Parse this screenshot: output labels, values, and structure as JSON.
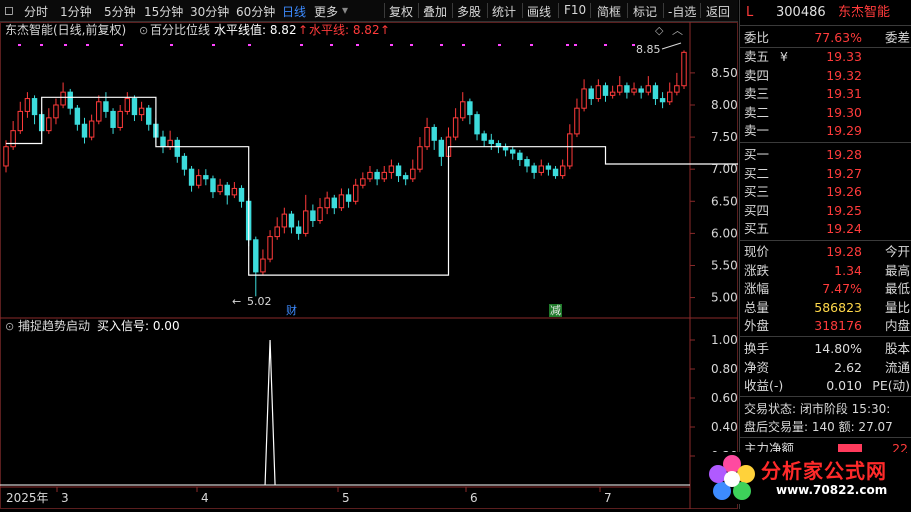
{
  "toolbar": {
    "periods": [
      "分时",
      "1分钟",
      "5分钟",
      "15分钟",
      "30分钟",
      "60分钟",
      "日线",
      "更多"
    ],
    "active_period": "日线",
    "actions": [
      "复权",
      "叠加",
      "多股",
      "统计",
      "画线",
      "F10",
      "简框",
      "标记",
      "-自选",
      "返回"
    ]
  },
  "chart": {
    "stock_title": "东杰智能(日线,前复权)",
    "indicator_name": "百分比位线",
    "indicator_value_label": "水平线值: 8.82",
    "indicator_value2_label": "水平线: 8.82",
    "price_axis": [
      "8.50",
      "8.00",
      "7.50",
      "7.00",
      "6.50",
      "6.00",
      "5.50",
      "5.00"
    ],
    "high_marker": "8.85",
    "low_marker": "5.02",
    "event_cai": "财",
    "event_jian": "减",
    "sub_indicator_name": "捕捉趋势启动",
    "sub_indicator_value": "买入信号: 0.00",
    "sub_axis": [
      "1.00",
      "0.80",
      "0.60",
      "0.40",
      "0.20"
    ],
    "date_labels": [
      "2025年",
      "3",
      "4",
      "5",
      "6",
      "7"
    ],
    "colors": {
      "up": "#ff3b3b",
      "down": "#3ddcdc",
      "line": "#ffffff",
      "magenta": "#ff44ff"
    }
  },
  "chart_data": {
    "type": "line",
    "title": "",
    "ylim": [
      4.9,
      8.95
    ],
    "candles": [
      [
        7.05,
        7.35,
        7.45,
        6.95
      ],
      [
        7.35,
        7.6,
        7.75,
        7.3
      ],
      [
        7.6,
        7.9,
        8.05,
        7.55
      ],
      [
        7.9,
        8.1,
        8.2,
        7.8
      ],
      [
        8.1,
        7.85,
        8.15,
        7.7
      ],
      [
        7.85,
        7.6,
        7.9,
        7.45
      ],
      [
        7.6,
        7.8,
        7.95,
        7.55
      ],
      [
        7.8,
        8.0,
        8.1,
        7.7
      ],
      [
        8.0,
        8.2,
        8.35,
        7.95
      ],
      [
        8.2,
        7.95,
        8.25,
        7.85
      ],
      [
        7.95,
        7.7,
        8.0,
        7.6
      ],
      [
        7.7,
        7.5,
        7.8,
        7.4
      ],
      [
        7.5,
        7.75,
        7.85,
        7.45
      ],
      [
        7.75,
        8.05,
        8.15,
        7.7
      ],
      [
        8.05,
        7.9,
        8.2,
        7.8
      ],
      [
        7.9,
        7.65,
        7.95,
        7.55
      ],
      [
        7.65,
        7.9,
        8.0,
        7.6
      ],
      [
        7.9,
        8.1,
        8.2,
        7.85
      ],
      [
        8.1,
        7.85,
        8.15,
        7.75
      ],
      [
        7.85,
        7.95,
        8.05,
        7.75
      ],
      [
        7.95,
        7.7,
        8.0,
        7.6
      ],
      [
        7.7,
        7.5,
        7.8,
        7.4
      ],
      [
        7.5,
        7.35,
        7.6,
        7.25
      ],
      [
        7.35,
        7.45,
        7.6,
        7.3
      ],
      [
        7.45,
        7.2,
        7.5,
        7.1
      ],
      [
        7.2,
        7.0,
        7.25,
        6.9
      ],
      [
        7.0,
        6.75,
        7.05,
        6.65
      ],
      [
        6.75,
        6.9,
        7.0,
        6.7
      ],
      [
        6.9,
        6.85,
        7.0,
        6.75
      ],
      [
        6.85,
        6.65,
        6.9,
        6.55
      ],
      [
        6.65,
        6.75,
        6.85,
        6.6
      ],
      [
        6.75,
        6.6,
        6.8,
        6.45
      ],
      [
        6.6,
        6.7,
        6.8,
        6.55
      ],
      [
        6.7,
        6.5,
        6.75,
        6.4
      ],
      [
        6.5,
        5.9,
        6.55,
        5.8
      ],
      [
        5.9,
        5.4,
        5.95,
        5.02
      ],
      [
        5.4,
        5.6,
        5.75,
        5.35
      ],
      [
        5.6,
        5.95,
        6.05,
        5.55
      ],
      [
        5.95,
        6.1,
        6.25,
        5.9
      ],
      [
        6.1,
        6.3,
        6.4,
        6.0
      ],
      [
        6.3,
        6.1,
        6.35,
        6.0
      ],
      [
        6.1,
        6.0,
        6.2,
        5.9
      ],
      [
        6.0,
        6.35,
        6.6,
        5.95
      ],
      [
        6.35,
        6.2,
        6.45,
        6.1
      ],
      [
        6.2,
        6.4,
        6.55,
        6.15
      ],
      [
        6.4,
        6.55,
        6.65,
        6.3
      ],
      [
        6.55,
        6.4,
        6.6,
        6.3
      ],
      [
        6.4,
        6.6,
        6.7,
        6.35
      ],
      [
        6.6,
        6.5,
        6.7,
        6.4
      ],
      [
        6.5,
        6.75,
        6.85,
        6.45
      ],
      [
        6.75,
        6.85,
        6.95,
        6.7
      ],
      [
        6.85,
        6.95,
        7.05,
        6.8
      ],
      [
        6.95,
        6.85,
        7.0,
        6.75
      ],
      [
        6.85,
        6.95,
        7.05,
        6.8
      ],
      [
        6.95,
        7.05,
        7.15,
        6.85
      ],
      [
        7.05,
        6.9,
        7.1,
        6.8
      ],
      [
        6.9,
        6.85,
        6.95,
        6.75
      ],
      [
        6.85,
        7.0,
        7.15,
        6.8
      ],
      [
        7.0,
        7.35,
        7.5,
        6.95
      ],
      [
        7.35,
        7.65,
        7.8,
        7.3
      ],
      [
        7.65,
        7.45,
        7.7,
        7.3
      ],
      [
        7.45,
        7.2,
        7.5,
        7.05
      ],
      [
        7.2,
        7.5,
        7.65,
        7.15
      ],
      [
        7.5,
        7.8,
        7.95,
        7.45
      ],
      [
        7.8,
        8.05,
        8.2,
        7.75
      ],
      [
        8.05,
        7.85,
        8.1,
        7.7
      ],
      [
        7.85,
        7.55,
        7.9,
        7.45
      ],
      [
        7.55,
        7.45,
        7.6,
        7.35
      ],
      [
        7.45,
        7.4,
        7.55,
        7.3
      ],
      [
        7.4,
        7.35,
        7.45,
        7.25
      ],
      [
        7.35,
        7.3,
        7.4,
        7.2
      ],
      [
        7.3,
        7.25,
        7.35,
        7.15
      ],
      [
        7.25,
        7.15,
        7.3,
        7.05
      ],
      [
        7.15,
        7.05,
        7.2,
        6.95
      ],
      [
        7.05,
        6.95,
        7.1,
        6.85
      ],
      [
        6.95,
        7.05,
        7.15,
        6.9
      ],
      [
        7.05,
        7.0,
        7.1,
        6.9
      ],
      [
        7.0,
        6.9,
        7.05,
        6.85
      ],
      [
        6.9,
        7.05,
        7.15,
        6.85
      ],
      [
        7.05,
        7.55,
        7.7,
        7.0
      ],
      [
        7.55,
        7.95,
        8.1,
        7.5
      ],
      [
        7.95,
        8.25,
        8.4,
        7.9
      ],
      [
        8.25,
        8.1,
        8.3,
        8.0
      ],
      [
        8.1,
        8.3,
        8.4,
        8.05
      ],
      [
        8.3,
        8.15,
        8.35,
        8.05
      ],
      [
        8.15,
        8.2,
        8.3,
        8.1
      ],
      [
        8.2,
        8.3,
        8.45,
        8.15
      ],
      [
        8.3,
        8.2,
        8.35,
        8.1
      ],
      [
        8.2,
        8.25,
        8.35,
        8.15
      ],
      [
        8.25,
        8.2,
        8.3,
        8.1
      ],
      [
        8.2,
        8.3,
        8.45,
        8.15
      ],
      [
        8.3,
        8.1,
        8.35,
        8.0
      ],
      [
        8.1,
        8.05,
        8.2,
        7.95
      ],
      [
        8.05,
        8.2,
        8.35,
        8.0
      ],
      [
        8.2,
        8.3,
        8.5,
        8.15
      ],
      [
        8.3,
        8.82,
        8.85,
        8.25
      ]
    ],
    "percent_line": [
      [
        0,
        7.4
      ],
      [
        5,
        7.4
      ],
      [
        5,
        8.12
      ],
      [
        21,
        8.12
      ],
      [
        21,
        7.35
      ],
      [
        34,
        7.35
      ],
      [
        34,
        5.35
      ],
      [
        62,
        5.35
      ],
      [
        62,
        7.35
      ],
      [
        84,
        7.35
      ],
      [
        84,
        7.08
      ],
      [
        110,
        7.08
      ],
      [
        110,
        8.85
      ]
    ],
    "signal": {
      "x_index": 37,
      "value": 1.0
    }
  },
  "panel": {
    "head": {
      "mark": "L",
      "code": "300486",
      "name": "东杰智能"
    },
    "ratio": {
      "label": "委比",
      "value": "77.63%",
      "right": "委差"
    },
    "sells": [
      {
        "label": "卖五",
        "flag": "¥",
        "price": "19.33"
      },
      {
        "label": "卖四",
        "flag": "",
        "price": "19.32"
      },
      {
        "label": "卖三",
        "flag": "",
        "price": "19.31"
      },
      {
        "label": "卖二",
        "flag": "",
        "price": "19.30"
      },
      {
        "label": "卖一",
        "flag": "",
        "price": "19.29"
      }
    ],
    "buys": [
      {
        "label": "买一",
        "price": "19.28"
      },
      {
        "label": "买二",
        "price": "19.27"
      },
      {
        "label": "买三",
        "price": "19.26"
      },
      {
        "label": "买四",
        "price": "19.25"
      },
      {
        "label": "买五",
        "price": "19.24"
      }
    ],
    "quote": [
      {
        "label": "现价",
        "value": "19.28",
        "right": "今开",
        "color": "red"
      },
      {
        "label": "涨跌",
        "value": "1.34",
        "right": "最高",
        "color": "red"
      },
      {
        "label": "涨幅",
        "value": "7.47%",
        "right": "最低",
        "color": "red"
      },
      {
        "label": "总量",
        "value": "586823",
        "right": "量比",
        "color": "yellow"
      },
      {
        "label": "外盘",
        "value": "318176",
        "right": "内盘",
        "color": "red"
      }
    ],
    "fund": [
      {
        "label": "换手",
        "value": "14.80%",
        "right": "股本"
      },
      {
        "label": "净资",
        "value": "2.62",
        "right": "流通"
      },
      {
        "label": "收益(-)",
        "value": "0.010",
        "right": "PE(动)"
      }
    ],
    "status": "交易状态: 闭市阶段 15:30:",
    "after": "盘后交易量: 140  额: 27.07",
    "main_net": {
      "label": "主力净额",
      "value": "22"
    },
    "watermark": {
      "text": "分析家公式网",
      "url": "www.70822.com"
    }
  }
}
